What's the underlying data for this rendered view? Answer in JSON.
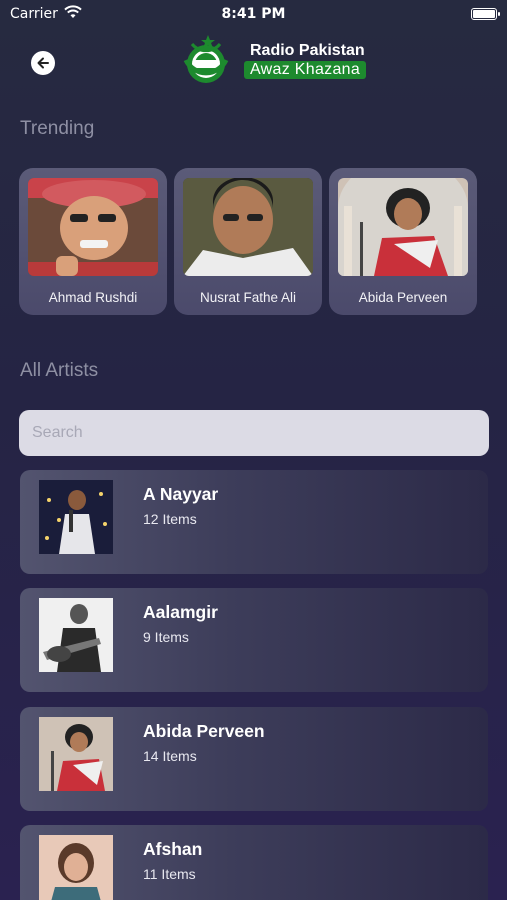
{
  "status_bar": {
    "carrier": "Carrier",
    "time": "8:41 PM",
    "icons": [
      "wifi-icon",
      "battery-icon"
    ]
  },
  "header": {
    "back_icon": "back-arrow-icon",
    "logo_title": "Radio Pakistan",
    "logo_subtitle": "Awaz Khazana",
    "brand_color": "#1d8a2e"
  },
  "trending": {
    "title": "Trending",
    "items": [
      {
        "name": "Ahmad Rushdi"
      },
      {
        "name": "Nusrat Fathe Ali"
      },
      {
        "name": "Abida Perveen"
      }
    ]
  },
  "all_artists": {
    "title": "All Artists",
    "search_placeholder": "Search",
    "items": [
      {
        "name": "A Nayyar",
        "count": "12 Items"
      },
      {
        "name": "Aalamgir",
        "count": "9 Items"
      },
      {
        "name": "Abida Perveen",
        "count": "14 Items"
      },
      {
        "name": "Afshan",
        "count": "11 Items"
      }
    ]
  },
  "colors": {
    "background": "#262a40",
    "card": "#55556f",
    "section_title": "#8e8fa3",
    "search_bg": "#dcdbe5"
  }
}
